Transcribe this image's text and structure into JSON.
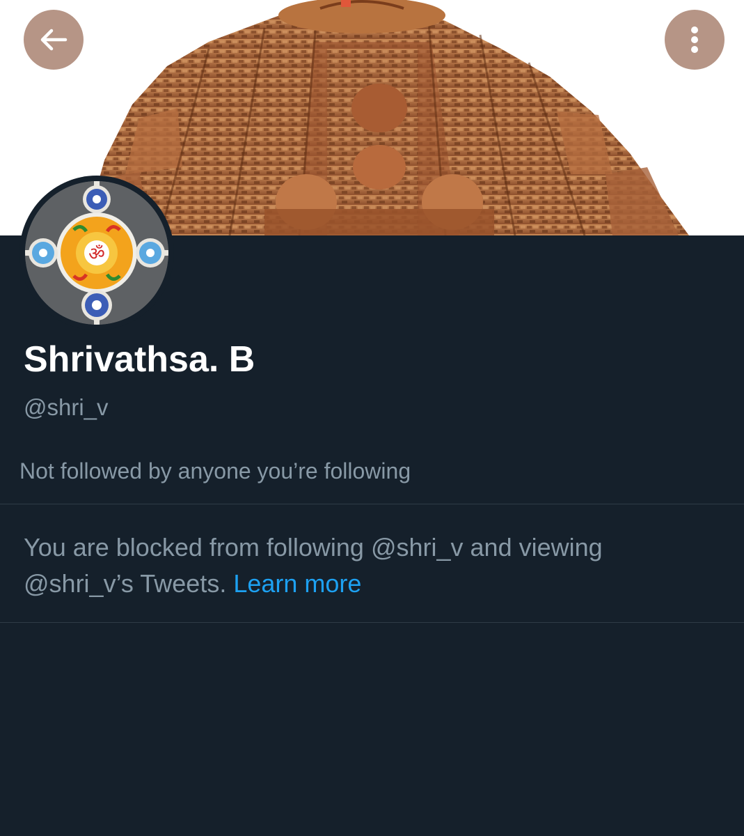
{
  "profile": {
    "display_name": "Shrivathsa. B",
    "handle": "@shri_v",
    "followers_note": "Not followed by anyone you’re following",
    "avatar_glyph": "ॐ"
  },
  "blocked_notice": {
    "line_1": "You are blocked from following @shri_v and viewing",
    "line_2": "@shri_v’s Tweets.",
    "link_label": "Learn more"
  },
  "icons": {
    "back": "arrow-left-icon",
    "more": "more-vertical-icon"
  },
  "colors": {
    "background": "#15202b",
    "primary_text": "#ffffff",
    "secondary_text": "#8899a6",
    "link": "#1da1f2",
    "nav_button": "#b08c7c"
  }
}
